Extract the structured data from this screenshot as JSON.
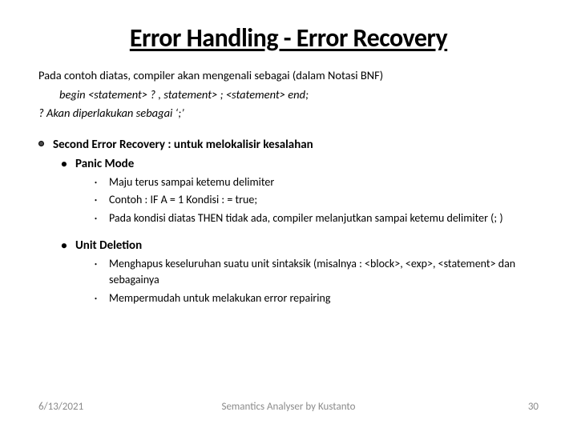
{
  "title": "Error Handling - Error Recovery",
  "intro": {
    "line1": "Pada contoh diatas, compiler akan mengenali sebagai (dalam Notasi BNF)",
    "line2": "begin  <statement>  ?  ,  statement>  ;  <statement> end;",
    "line3": "? Akan diperlakukan sebagai ‘;’"
  },
  "sec": {
    "heading": "Second Error Recovery : untuk melokalisir kesalahan",
    "panic": {
      "label": "Panic Mode",
      "items": [
        "Maju terus sampai ketemu delimiter",
        "Contoh : IF A = 1  Kondisi : =  true;",
        "Pada kondisi diatas THEN  tidak ada, compiler melanjutkan sampai ketemu delimiter (; )"
      ]
    },
    "unit": {
      "label": "Unit Deletion",
      "items": [
        "Menghapus keseluruhan suatu unit sintaksik (misalnya : <block>, <exp>, <statement> dan sebagainya",
        "Mempermudah untuk melakukan error repairing"
      ]
    }
  },
  "footer": {
    "date": "6/13/2021",
    "center": "Semantics Analyser by Kustanto",
    "page": "30"
  }
}
